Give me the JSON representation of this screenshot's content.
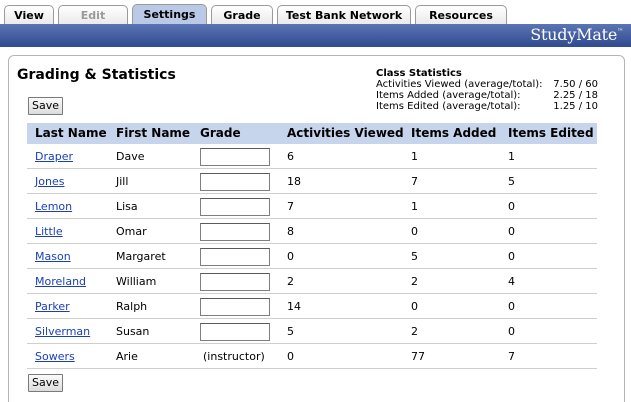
{
  "tabs": [
    {
      "label": "View",
      "state": "normal"
    },
    {
      "label": "Edit",
      "state": "disabled"
    },
    {
      "label": "Settings",
      "state": "active"
    },
    {
      "label": "Grade",
      "state": "normal"
    },
    {
      "label": "Test Bank Network",
      "state": "normal"
    },
    {
      "label": "Resources",
      "state": "normal"
    }
  ],
  "brand": {
    "name": "StudyMate",
    "mark": "™"
  },
  "colors": {
    "header_bar": "#3b559b",
    "table_header": "#c6d4ec",
    "link": "#1a3fb8",
    "active_tab": "#b9c9e6"
  },
  "page": {
    "title": "Grading & Statistics",
    "save_label": "Save"
  },
  "stats": {
    "title": "Class Statistics",
    "rows": [
      {
        "label": "Activities Viewed (average/total):",
        "value": "7.50 / 60"
      },
      {
        "label": "Items Added (average/total):",
        "value": "2.25 / 18"
      },
      {
        "label": "Items Edited (average/total):",
        "value": "1.25 / 10"
      }
    ]
  },
  "table": {
    "headers": [
      "Last Name",
      "First Name",
      "Grade",
      "Activities Viewed",
      "Items Added",
      "Items Edited"
    ],
    "rows": [
      {
        "last": "Draper",
        "first": "Dave",
        "grade": "",
        "viewed": "6",
        "added": "1",
        "edited": "1"
      },
      {
        "last": "Jones",
        "first": "Jill",
        "grade": "",
        "viewed": "18",
        "added": "7",
        "edited": "5"
      },
      {
        "last": "Lemon",
        "first": "Lisa",
        "grade": "",
        "viewed": "7",
        "added": "1",
        "edited": "0"
      },
      {
        "last": "Little",
        "first": "Omar",
        "grade": "",
        "viewed": "8",
        "added": "0",
        "edited": "0"
      },
      {
        "last": "Mason",
        "first": "Margaret",
        "grade": "",
        "viewed": "0",
        "added": "5",
        "edited": "0"
      },
      {
        "last": "Moreland",
        "first": "William",
        "grade": "",
        "viewed": "2",
        "added": "2",
        "edited": "4"
      },
      {
        "last": "Parker",
        "first": "Ralph",
        "grade": "",
        "viewed": "14",
        "added": "0",
        "edited": "0"
      },
      {
        "last": "Silverman",
        "first": "Susan",
        "grade": "",
        "viewed": "5",
        "added": "2",
        "edited": "0"
      },
      {
        "last": "Sowers",
        "first": "Arie",
        "grade_text": "(instructor)",
        "viewed": "0",
        "added": "77",
        "edited": "7"
      }
    ]
  }
}
